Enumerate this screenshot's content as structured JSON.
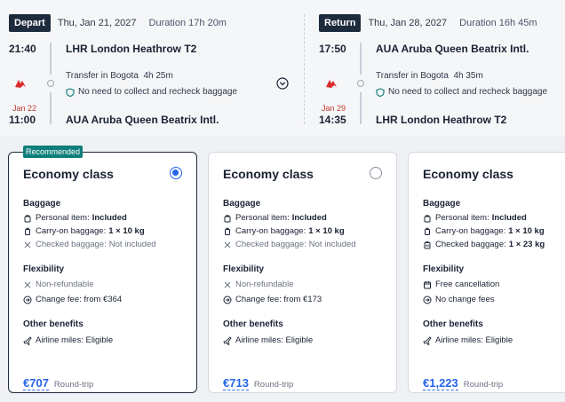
{
  "depart": {
    "tag": "Depart",
    "date": "Thu, Jan 21, 2027",
    "duration": "Duration 17h 20m",
    "dep_time": "21:40",
    "dep_place": "LHR London Heathrow T2",
    "transfer": "Transfer in Bogota",
    "transfer_dur": "4h 25m",
    "recheck": "No need to collect and recheck baggage",
    "arr_date": "Jan 22",
    "arr_time": "11:00",
    "arr_place": "AUA Aruba Queen Beatrix Intl."
  },
  "return": {
    "tag": "Return",
    "date": "Thu, Jan 28, 2027",
    "duration": "Duration 16h 45m",
    "dep_time": "17:50",
    "dep_place": "AUA Aruba Queen Beatrix Intl.",
    "transfer": "Transfer in Bogota",
    "transfer_dur": "4h 35m",
    "recheck": "No need to collect and recheck baggage",
    "arr_date": "Jan 29",
    "arr_time": "14:35",
    "arr_place": "LHR London Heathrow T2"
  },
  "recommended_badge": "Recommended",
  "fares": [
    {
      "title": "Economy class",
      "selected": true,
      "baggage_label": "Baggage",
      "personal_label": "Personal item:",
      "personal_val": "Included",
      "carry_label": "Carry-on baggage:",
      "carry_val": "1 × 10 kg",
      "checked_label": "Checked baggage:",
      "checked_val": "Not included",
      "flex_label": "Flexibility",
      "flex1": "Non-refundable",
      "flex2": "Change fee: from €364",
      "other_label": "Other benefits",
      "benefit": "Airline miles: Eligible",
      "price": "€707",
      "price_note": "Round-trip"
    },
    {
      "title": "Economy class",
      "selected": false,
      "baggage_label": "Baggage",
      "personal_label": "Personal item:",
      "personal_val": "Included",
      "carry_label": "Carry-on baggage:",
      "carry_val": "1 × 10 kg",
      "checked_label": "Checked baggage:",
      "checked_val": "Not included",
      "flex_label": "Flexibility",
      "flex1": "Non-refundable",
      "flex2": "Change fee: from €173",
      "other_label": "Other benefits",
      "benefit": "Airline miles: Eligible",
      "price": "€713",
      "price_note": "Round-trip"
    },
    {
      "title": "Economy class",
      "selected": false,
      "baggage_label": "Baggage",
      "personal_label": "Personal item:",
      "personal_val": "Included",
      "carry_label": "Carry-on baggage:",
      "carry_val": "1 × 10 kg",
      "checked_label": "Checked baggage:",
      "checked_val": "1 × 23 kg",
      "flex_label": "Flexibility",
      "flex1": "Free cancellation",
      "flex2": "No change fees",
      "other_label": "Other benefits",
      "benefit": "Airline miles: Eligible",
      "price": "€1,223",
      "price_note": "Round-trip"
    }
  ],
  "colors": {
    "accent": "#2563eb",
    "tag_bg": "#1d2b3c",
    "recommended": "#0f7f7a",
    "alert_date": "#c0392b"
  }
}
